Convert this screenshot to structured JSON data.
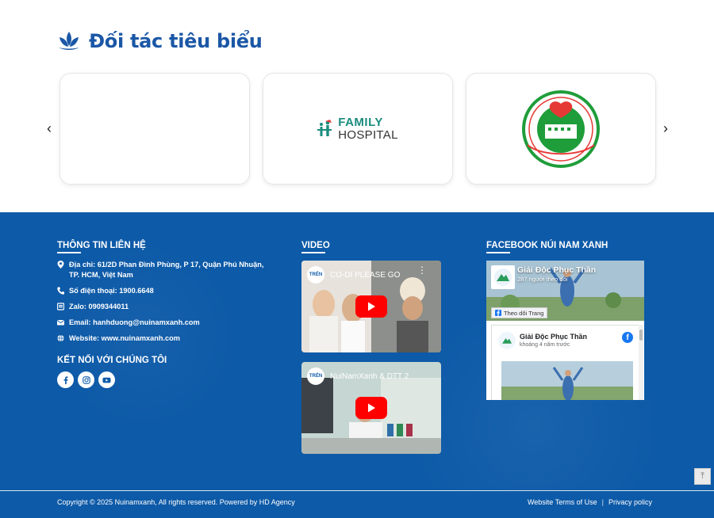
{
  "partners": {
    "title": "Đối tác tiêu biểu",
    "arrow_prev": "‹",
    "arrow_next": "›",
    "family_hospital": {
      "line1": "FAMILY",
      "line2": "HOSPITAL"
    },
    "oncology_icon": "oncology-hospital-seal",
    "colors": {
      "title": "#1b57a6",
      "family_teal": "#1a8c7e"
    }
  },
  "footer": {
    "contact": {
      "title": "THÔNG TIN LIÊN HỆ",
      "items": [
        {
          "icon": "location-pin-icon",
          "text": "Địa chỉ: 61/2D Phan Đình Phùng, P 17, Quận Phú Nhuận, TP. HCM, Việt Nam"
        },
        {
          "icon": "phone-icon",
          "text": "Số điện thoại: 1900.6648"
        },
        {
          "icon": "zalo-icon",
          "text": "Zalo: 0909344011"
        },
        {
          "icon": "mail-icon",
          "text": "Email: hanhduong@nuinamxanh.com"
        },
        {
          "icon": "globe-icon",
          "text": "Website: www.nuinamxanh.com"
        }
      ]
    },
    "connect": {
      "title": "KẾT NỐI VỚI CHÚNG TÔI",
      "socials": [
        "facebook-icon",
        "instagram-icon",
        "youtube-icon"
      ]
    },
    "video": {
      "title": "VIDEO",
      "items": [
        {
          "title": "CO-DI PLEASE GO",
          "channel": "TRẺN"
        },
        {
          "title": "NuiNamXanh & DTT 2",
          "channel": "TRẺN"
        }
      ]
    },
    "facebook": {
      "title": "FACEBOOK NÚI NAM XANH",
      "page_name": "Giải Độc Phục Thần",
      "followers": "287 người theo dõi",
      "follow_button": "Theo dõi Trang",
      "post_name": "Giải Độc Phục Thần",
      "post_time": "khoảng 4 năm trước"
    },
    "back_to_top": "⤒",
    "bottom": {
      "copyright": "Copyright © 2025 Nuinamxanh, All rights reserved.  Powered by HD Agency",
      "terms": "Website Terms of Use",
      "separator": "|",
      "privacy": "Privacy policy"
    },
    "colors": {
      "background": "#0d5aa8",
      "play": "#ff0000",
      "facebook": "#1877f2"
    }
  }
}
